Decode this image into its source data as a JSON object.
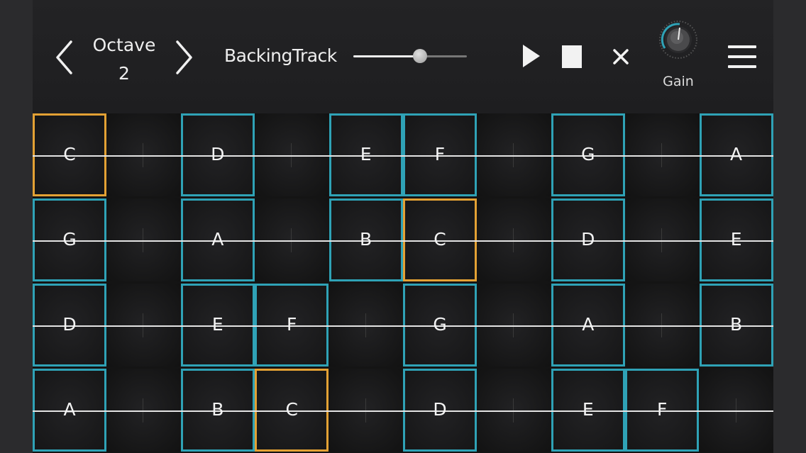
{
  "header": {
    "octave_label": "Octave",
    "octave_value": "2",
    "backing_label": "BackingTrack",
    "backing_volume": 0.59,
    "gain_label": "Gain"
  },
  "colors": {
    "scale_outline": "#2fa2b6",
    "root_outline": "#e3a134",
    "background": "#1c1c1e"
  },
  "icons": {
    "prev": "chevron-left-icon",
    "next": "chevron-right-icon",
    "play": "play-icon",
    "stop": "stop-icon",
    "close": "close-icon",
    "gain": "gain-knob-icon",
    "menu": "hamburger-menu-icon"
  },
  "fretboard": {
    "rows": [
      {
        "cells": [
          {
            "note": "C",
            "state": "root"
          },
          {
            "note": "",
            "state": "off"
          },
          {
            "note": "D",
            "state": "scale"
          },
          {
            "note": "",
            "state": "off"
          },
          {
            "note": "E",
            "state": "scale"
          },
          {
            "note": "F",
            "state": "scale"
          },
          {
            "note": "",
            "state": "off"
          },
          {
            "note": "G",
            "state": "scale"
          },
          {
            "note": "",
            "state": "off"
          },
          {
            "note": "A",
            "state": "scale"
          }
        ]
      },
      {
        "cells": [
          {
            "note": "G",
            "state": "scale"
          },
          {
            "note": "",
            "state": "off"
          },
          {
            "note": "A",
            "state": "scale"
          },
          {
            "note": "",
            "state": "off"
          },
          {
            "note": "B",
            "state": "scale"
          },
          {
            "note": "C",
            "state": "root"
          },
          {
            "note": "",
            "state": "off"
          },
          {
            "note": "D",
            "state": "scale"
          },
          {
            "note": "",
            "state": "off"
          },
          {
            "note": "E",
            "state": "scale"
          }
        ]
      },
      {
        "cells": [
          {
            "note": "D",
            "state": "scale"
          },
          {
            "note": "",
            "state": "off"
          },
          {
            "note": "E",
            "state": "scale"
          },
          {
            "note": "F",
            "state": "scale"
          },
          {
            "note": "",
            "state": "off"
          },
          {
            "note": "G",
            "state": "scale"
          },
          {
            "note": "",
            "state": "off"
          },
          {
            "note": "A",
            "state": "scale"
          },
          {
            "note": "",
            "state": "off"
          },
          {
            "note": "B",
            "state": "scale"
          }
        ]
      },
      {
        "cells": [
          {
            "note": "A",
            "state": "scale"
          },
          {
            "note": "",
            "state": "off"
          },
          {
            "note": "B",
            "state": "scale"
          },
          {
            "note": "C",
            "state": "root"
          },
          {
            "note": "",
            "state": "off"
          },
          {
            "note": "D",
            "state": "scale"
          },
          {
            "note": "",
            "state": "off"
          },
          {
            "note": "E",
            "state": "scale"
          },
          {
            "note": "F",
            "state": "scale"
          },
          {
            "note": "",
            "state": "off"
          }
        ]
      }
    ]
  }
}
